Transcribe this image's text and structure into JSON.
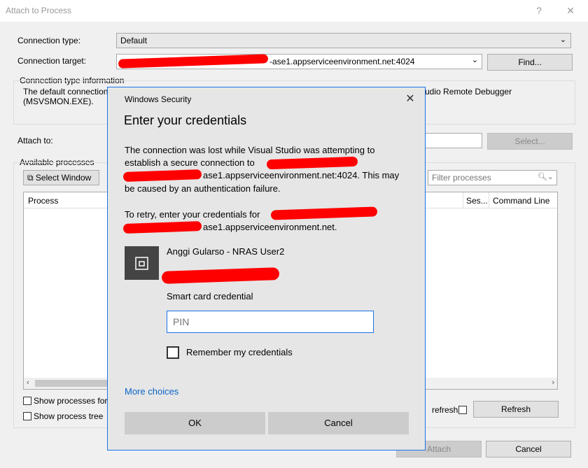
{
  "window": {
    "title": "Attach to Process",
    "help": "?",
    "close": "✕"
  },
  "connection": {
    "type_label": "Connection type:",
    "type_value": "Default",
    "target_label": "Connection target:",
    "target_value_suffix": "-ase1.appserviceenvironment.net:4024",
    "find_button": "Find...",
    "info_title": "Connection type information",
    "info_text_line1": "The default connection",
    "info_text_line1_end": "udio Remote Debugger",
    "info_text_line2": "(MSVSMON.EXE)."
  },
  "attach": {
    "label": "Attach to:",
    "select_button": "Select..."
  },
  "processes": {
    "group_title": "Available processes",
    "select_window_button": "Select Window",
    "filter_placeholder": "Filter processes",
    "columns": {
      "process": "Process",
      "session": "Ses...",
      "command_line": "Command Line"
    },
    "show_for_label": "Show processes for",
    "show_tree_label": "Show process tree",
    "auto_refresh_label": "refresh",
    "refresh_button": "Refresh"
  },
  "footer": {
    "attach_button": "Attach",
    "cancel_button": "Cancel"
  },
  "modal": {
    "window_title": "Windows Security",
    "close": "✕",
    "heading": "Enter your credentials",
    "message_line1": "The connection was lost while Visual Studio was attempting to",
    "message_line2": "establish a secure connection to",
    "message_line3_suffix": "ase1.appserviceenvironment.net:4024. This may",
    "message_line4": "be caused by an authentication failure.",
    "retry_line1": "To retry, enter your credentials for",
    "retry_line2_suffix": "ase1.appserviceenvironment.net.",
    "user_name": "Anggi Gularso - NRAS User2",
    "credential_type": "Smart card credential",
    "pin_placeholder": "PIN",
    "remember_label": "Remember my credentials",
    "more_choices": "More choices",
    "ok_button": "OK",
    "cancel_button": "Cancel"
  },
  "colors": {
    "accent": "#1a73e8",
    "link": "#0a64c8",
    "redaction": "#ff0000"
  }
}
